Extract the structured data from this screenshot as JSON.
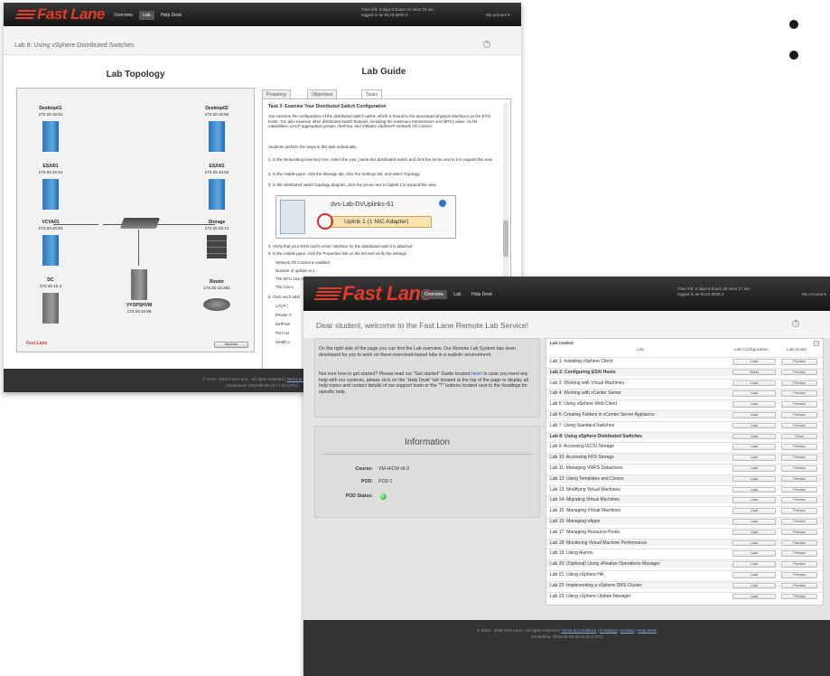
{
  "brand": {
    "logo_text": "Fast Lane"
  },
  "window1": {
    "nav": [
      "Overview",
      "Lab",
      "Help Desk"
    ],
    "timer": "Time left: 3 days 6 hours 41 mins 23 sec",
    "logged_in": "logged in as RL23.5930.4",
    "account": "My account ▾",
    "lab_title": "Lab 8: Using vSphere Distributed Switches",
    "topology_title": "Lab Topology",
    "guide_title": "Lab Guide",
    "tabs": [
      "Preparing",
      "Objectives",
      "Tasks"
    ],
    "nodes": [
      {
        "name": "Desktop01",
        "ip": "172.20.10.91"
      },
      {
        "name": "Desktop02",
        "ip": "172.20.10.92"
      },
      {
        "name": "ESXi01",
        "ip": "172.20.10.51"
      },
      {
        "name": "ESXi02",
        "ip": "172.20.10.52"
      },
      {
        "name": "VCVA01",
        "ip": "172.20.10.94"
      },
      {
        "name": "Storage",
        "ip": "172.20.10.14"
      },
      {
        "name": "DC",
        "ip": "172.20.10.3"
      },
      {
        "name": "VYOPSHVM",
        "ip": "172.20.10.96"
      },
      {
        "name": "Router",
        "ip": "172.20.10.254"
      }
    ],
    "topology_logo": "Fast Lane",
    "topology_button": "Maximize",
    "guide": {
      "heading": "Task 3: Examine Your Distributed Switch Configuration",
      "para1": "You examine the configuration of the distributed switch uplink, which is bound to the associated physical interfaces on the ESXi hosts. You also examine other distributed switch features, including the maximum transmission unit (MTU) value, VLAN capabilities, LACP aggregation groups, NetFlow, and VMware vSphere® Network I/O Control.",
      "para2": "Students perform the steps in this task individually.",
      "step1": "1. In the Networking inventory tree, select the your_name-dvs distributed switch and click the arrow next to it to expand the view.",
      "step2": "2. In the middle pane, click the Manage tab, click the Settings tab, and select Topology.",
      "step3": "3. In the distributed switch topology diagram, click the arrow next to Uplink 1 to expand the view.",
      "diagram_label1": "dvs-Lab-DVUplinks-61",
      "diagram_label2": "Uplink 1 (1 NIC Adapter)",
      "step4": "4. Verify that your ESXi host's vmnic interface for the distributed switch is attached",
      "step5": "5. In the middle pane, click the Properties link on the left and verify the settings.",
      "bullets": [
        "Network I/O Control is enabled",
        "Number of uplinks is 1",
        "The MTU size is 1500 bytes",
        "The Cisco"
      ],
      "step6": "6. Click each addi",
      "bullets2": [
        "LACP l",
        "Private V",
        "NetFlow",
        "Port mir",
        "Health c"
      ]
    },
    "footer_left": "© 2012 - 2016 Fast Lane - All rights reserved |",
    "footer_link": "Terms & Conditions",
    "footer_right": "Servertime: 2016-06-09 10:17:40 (UTC)"
  },
  "window2": {
    "nav": [
      "Overview",
      "Lab",
      "Help Desk"
    ],
    "timer": "Time left: 3 days 6 hours 36 mins 17 sec",
    "logged_in": "logged in as RL23.5930.4",
    "account": "My Account ▾",
    "welcome_title": "Dear student, welcome to the Fast Lane Remote Lab Service!",
    "intro_p1": "On the right side of the page you can find the Lab overview. Our Remote Lab System has been developed for you to work on these exercised-based labs in a realistic environment.",
    "intro_p2a": "Not sure how to get started? Please read our \"Get started\" Guide located ",
    "intro_link": "here",
    "intro_p2b": "! In case you need any help with our systems, please click on the \"Help Desk\" tab located at the top of the page to display all help topics and contact details of our support team or the \"?\" buttons located next to the headings for specific help.",
    "info_title": "Information",
    "info": [
      {
        "key": "Course:",
        "value": "VM-HICM v6.0"
      },
      {
        "key": "POD:",
        "value": "POD 2"
      },
      {
        "key": "POD Status:",
        "value": ""
      }
    ],
    "table": {
      "caption": "Lab Control",
      "headers": [
        "Lab",
        "Lab Configuration",
        "Lab Guide"
      ],
      "rows": [
        {
          "lab": "Lab 1: Installing vSphere Client",
          "config": "Load",
          "guide": "Preview"
        },
        {
          "lab": "Lab 2: Configuring ESXi Hosts",
          "config": "Reset",
          "guide": "Preview"
        },
        {
          "lab": "Lab 3: Working with Virtual Machines",
          "config": "Load",
          "guide": "Preview"
        },
        {
          "lab": "Lab 4: Working with vCenter Server",
          "config": "Load",
          "guide": "Preview"
        },
        {
          "lab": "Lab 5: Using vSphere Web Client",
          "config": "Load",
          "guide": "Preview"
        },
        {
          "lab": "Lab 6: Creating Folders in vCenter Server Appliance",
          "config": "Load",
          "guide": "Preview"
        },
        {
          "lab": "Lab 7: Using Standard Switches",
          "config": "Load",
          "guide": "Preview"
        },
        {
          "lab": "Lab 8: Using vSphere Distributed Switches",
          "config": "Load",
          "guide": "Show"
        },
        {
          "lab": "Lab 9: Accessing iSCSI Storage",
          "config": "Load",
          "guide": "Preview"
        },
        {
          "lab": "Lab 10: Accessing NFS Storage",
          "config": "Load",
          "guide": "Preview"
        },
        {
          "lab": "Lab 11: Managing VMFS Datastores",
          "config": "Load",
          "guide": "Preview"
        },
        {
          "lab": "Lab 12: Using Templates and Clones",
          "config": "Load",
          "guide": "Preview"
        },
        {
          "lab": "Lab 13: Modifying Virtual Machines",
          "config": "Load",
          "guide": "Preview"
        },
        {
          "lab": "Lab 14: Migrating Virtual Machines",
          "config": "Load",
          "guide": "Preview"
        },
        {
          "lab": "Lab 15: Managing Virtual Machines",
          "config": "Load",
          "guide": "Preview"
        },
        {
          "lab": "Lab 16: Managing vApps",
          "config": "Load",
          "guide": "Preview"
        },
        {
          "lab": "Lab 17: Managing Resource Pools",
          "config": "Load",
          "guide": "Preview"
        },
        {
          "lab": "Lab 18: Monitoring Virtual Machine Performance",
          "config": "Load",
          "guide": "Preview"
        },
        {
          "lab": "Lab 19: Using Alarms",
          "config": "Load",
          "guide": "Preview"
        },
        {
          "lab": "Lab 20: (Optional) Using vRealize Operations Manager",
          "config": "Load",
          "guide": "Preview"
        },
        {
          "lab": "Lab 21: Using vSphere HA",
          "config": "Load",
          "guide": "Preview"
        },
        {
          "lab": "Lab 22: Implementing a vSphere DRS Cluster",
          "config": "Load",
          "guide": "Preview"
        },
        {
          "lab": "Lab 23: Using vSphere Update Manager",
          "config": "Load",
          "guide": "Preview"
        }
      ]
    },
    "footer_left": "© 2012 - 2016 Fast Lane - All rights reserved |",
    "footer_links": [
      "Terms & Conditions",
      "Company",
      "Contact",
      "Help Desk"
    ],
    "footer_right": "Servertime: 2016-06-09 10:22:10 (UTC)"
  },
  "colors": {
    "brand_red": "#e23b2c",
    "topbar": "#1f1f1f",
    "swoosh_teal": "#1c4a57",
    "swoosh_red": "#b3202a"
  }
}
